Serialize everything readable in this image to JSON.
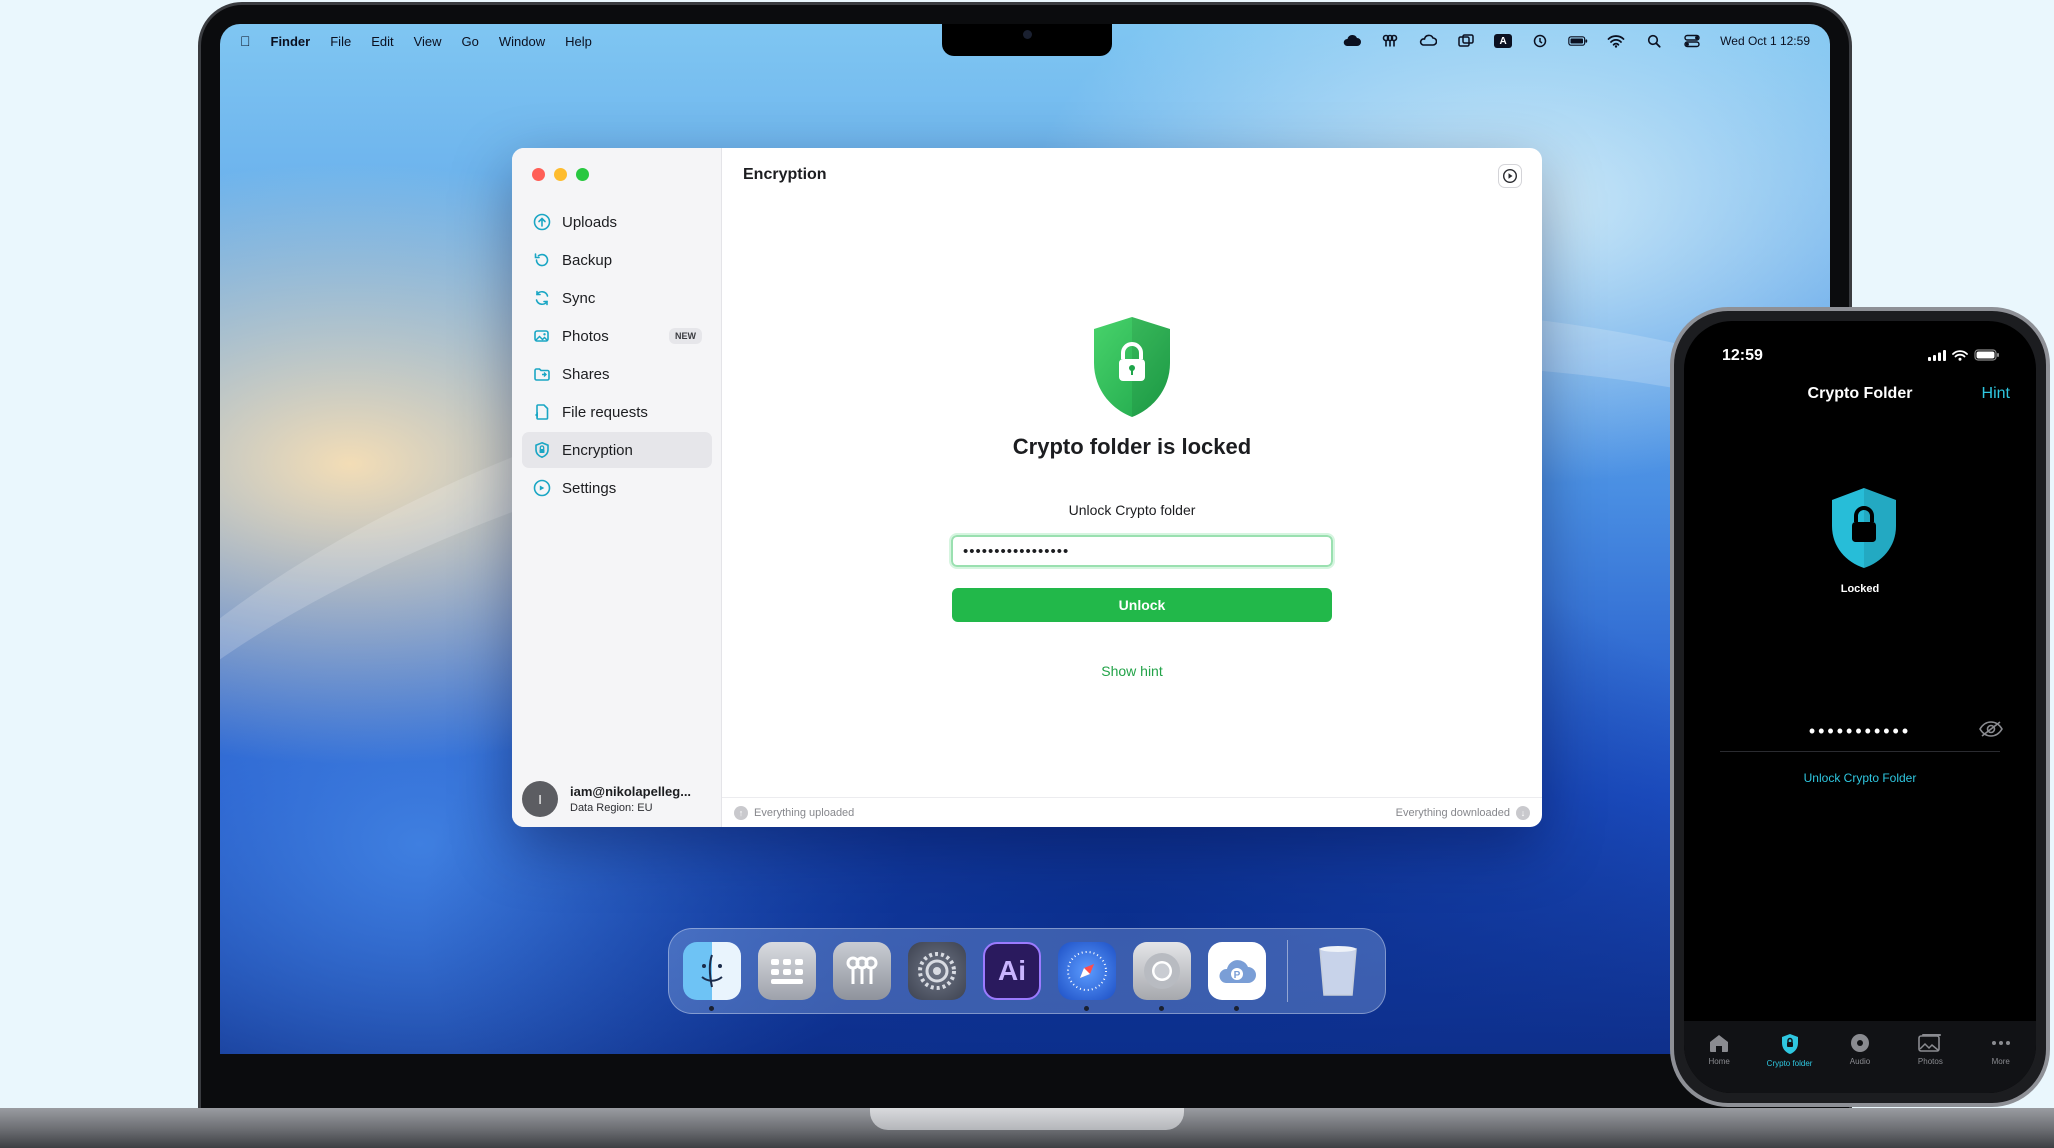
{
  "menubar": {
    "app": "Finder",
    "items": [
      "File",
      "Edit",
      "View",
      "Go",
      "Window",
      "Help"
    ],
    "datetime": "Wed Oct 1  12:59",
    "input_source": "A"
  },
  "window": {
    "sidebar": {
      "items": [
        {
          "label": "Uploads"
        },
        {
          "label": "Backup"
        },
        {
          "label": "Sync"
        },
        {
          "label": "Photos",
          "badge": "NEW"
        },
        {
          "label": "Shares"
        },
        {
          "label": "File requests"
        },
        {
          "label": "Encryption",
          "active": true
        },
        {
          "label": "Settings"
        }
      ],
      "account": {
        "avatar_initial": "I",
        "email": "iam@nikolapelleg...",
        "region": "Data Region: EU"
      }
    },
    "main": {
      "title": "Encryption",
      "locked_title": "Crypto folder is locked",
      "unlock_label": "Unlock Crypto folder",
      "password_value": "•••••••••••••••••",
      "unlock_button": "Unlock",
      "show_hint": "Show hint"
    },
    "status": {
      "left": "Everything uploaded",
      "right": "Everything downloaded"
    }
  },
  "dock": {
    "apps": [
      {
        "icon": "finder-icon",
        "running": true
      },
      {
        "icon": "launchpad-icon",
        "running": false
      },
      {
        "icon": "keychain-icon",
        "running": false
      },
      {
        "icon": "system-settings-icon",
        "running": false
      },
      {
        "icon": "illustrator-icon",
        "label": "Ai",
        "running": false
      },
      {
        "icon": "safari-icon",
        "running": true
      },
      {
        "icon": "chrome-icon",
        "running": true
      },
      {
        "icon": "pcloud-icon",
        "running": true
      },
      {
        "icon": "trash-icon",
        "running": false
      }
    ]
  },
  "phone": {
    "time": "12:59",
    "title": "Crypto Folder",
    "hint": "Hint",
    "locked_label": "Locked",
    "password_value": "•••••••••••",
    "unlock_link": "Unlock Crypto Folder",
    "tabs": [
      {
        "label": "Home",
        "icon": "home-icon"
      },
      {
        "label": "Crypto folder",
        "icon": "shield-lock-icon",
        "active": true
      },
      {
        "label": "Audio",
        "icon": "audio-icon"
      },
      {
        "label": "Photos",
        "icon": "photos-icon"
      },
      {
        "label": "More",
        "icon": "more-icon"
      }
    ]
  },
  "colors": {
    "accent_green": "#22b84a",
    "shield_green": "#2fbf5a",
    "phone_accent": "#2fc7e0",
    "sidebar_icon": "#1aa6c4"
  }
}
